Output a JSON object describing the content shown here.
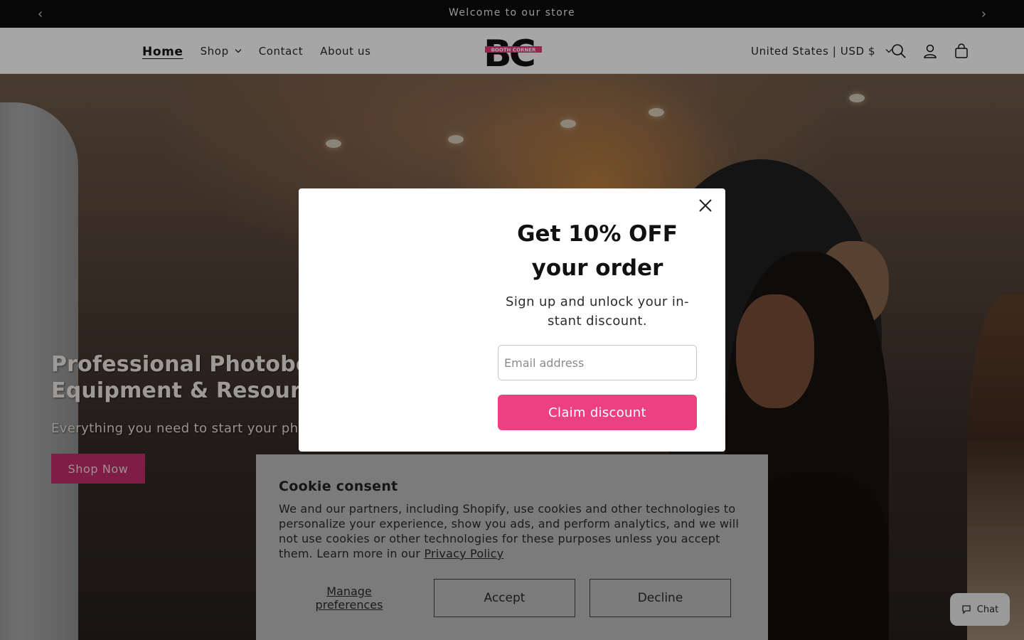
{
  "announcement": {
    "text": "Welcome to our store",
    "prev_icon": "chevron-left-icon",
    "next_icon": "chevron-right-icon"
  },
  "header": {
    "nav": [
      {
        "label": "Home",
        "active": true
      },
      {
        "label": "Shop",
        "has_dropdown": true
      },
      {
        "label": "Contact"
      },
      {
        "label": "About us"
      }
    ],
    "logo": {
      "letters": "BC",
      "band_text": "BOOTH CORNER",
      "band_color": "#e23d7c"
    },
    "country_selector": "United States | USD $",
    "icons": [
      "search-icon",
      "account-icon",
      "cart-icon"
    ]
  },
  "hero": {
    "title_line1": "Professional Photobooth",
    "title_line2": "Equipment & Resources",
    "subtitle": "Everything you need to start your photo",
    "button_label": "Shop Now",
    "button_color": "#c22e6a"
  },
  "popup": {
    "heading_line1": "Get 10% OFF",
    "heading_line2": "your order",
    "subtext": "Sign up and unlock your in-stant discount.",
    "email_placeholder": "Email address",
    "button_label": "Claim discount",
    "button_color": "#ec4083"
  },
  "cookie": {
    "title": "Cookie consent",
    "body": "We and our partners, including Shopify, use cookies and other technologies to personalize your experience, show you ads, and perform analytics, and we will not use cookies or other technologies for these purposes unless you accept them. Learn more in our",
    "link_label": "Privacy Policy",
    "manage_label": "Manage preferences",
    "accept_label": "Accept",
    "decline_label": "Decline"
  },
  "chat": {
    "label": "Chat",
    "icon": "chat-bubble-icon"
  }
}
